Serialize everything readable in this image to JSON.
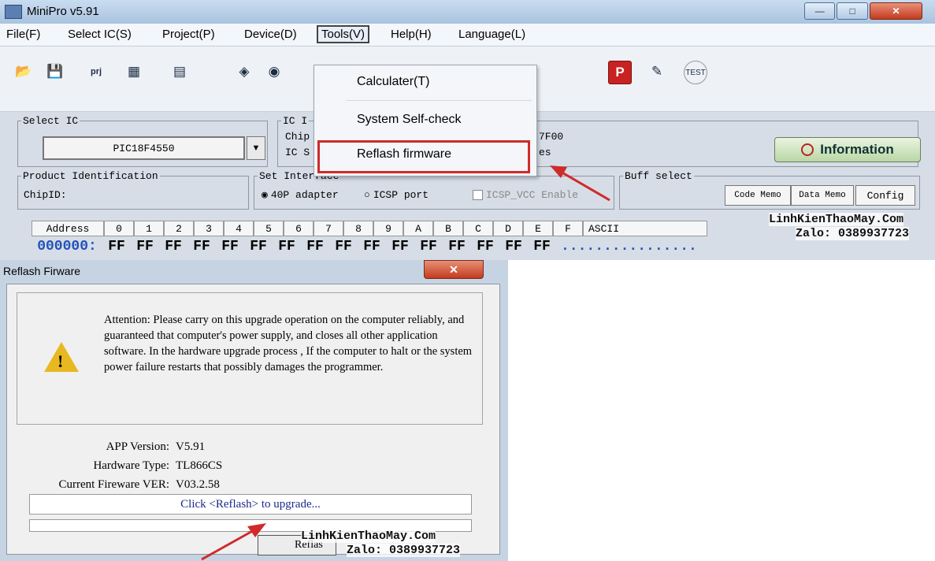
{
  "main_window": {
    "title": "MiniPro v5.91",
    "menu": [
      "File(F)",
      "Select IC(S)",
      "Project(P)",
      "Device(D)",
      "Tools(V)",
      "Help(H)",
      "Language(L)"
    ],
    "toolbar_icons": [
      "open-icon",
      "save-icon",
      "project-icon",
      "chip-icon",
      "memory-icon",
      "read-icon",
      "verify-icon",
      "p-icon",
      "edit-icon",
      "test-icon"
    ],
    "toolbar_text": {
      "prj": "prj",
      "p": "P",
      "test": "TEST"
    },
    "select_ic": {
      "legend": "Select IC",
      "chip": "PIC18F4550"
    },
    "ic_info": {
      "legend_partial": "IC I",
      "line1_partial": "Chip",
      "line2_partial": "IC S",
      "line1_right": "7F00",
      "line2_right": "es"
    },
    "information_label": "Information",
    "product_identification": {
      "legend": "Product Identification",
      "chip_id": "ChipID:"
    },
    "set_interface": {
      "legend": "Set Interface",
      "opt1": "40P adapter",
      "opt2": "ICSP port",
      "icsp_vcc": "ICSP_VCC Enable"
    },
    "buff_select": {
      "legend": "Buff select",
      "code_memo": "Code Memo",
      "data_memo": "Data Memo",
      "config": "Config"
    },
    "hex_header": [
      "Address",
      "0",
      "1",
      "2",
      "3",
      "4",
      "5",
      "6",
      "7",
      "8",
      "9",
      "A",
      "B",
      "C",
      "D",
      "E",
      "F",
      "ASCII"
    ],
    "hex_row": {
      "address": "000000:",
      "bytes": [
        "FF",
        "FF",
        "FF",
        "FF",
        "FF",
        "FF",
        "FF",
        "FF",
        "FF",
        "FF",
        "FF",
        "FF",
        "FF",
        "FF",
        "FF",
        "FF"
      ],
      "ascii": "................"
    }
  },
  "tools_menu": {
    "items": [
      "Calculater(T)",
      "System Self-check",
      "Reflash firmware"
    ],
    "highlighted": "Reflash firmware",
    "highlight_color": "#d02a2a"
  },
  "watermark": {
    "line1": "LinhKienThaoMay.Com",
    "line2": "Zalo: 0389937723"
  },
  "dialog": {
    "title": "Reflash Firware",
    "notice": "Attention: Please  carry on this upgrade operation on the computer reliably, and guaranteed that computer's power supply, and closes all other application software. In the hardware upgrade process , If the computer to halt or the system power failure restarts that possibly damages the programmer.",
    "app_version_label": "APP Version:",
    "app_version": "V5.91",
    "hardware_type_label": "Hardware Type:",
    "hardware_type": "TL866CS",
    "firmware_label": "Current Fireware VER:",
    "firmware": "V03.2.58",
    "status": "Click <Reflash> to upgrade...",
    "reflash_partial": "Reflas"
  }
}
